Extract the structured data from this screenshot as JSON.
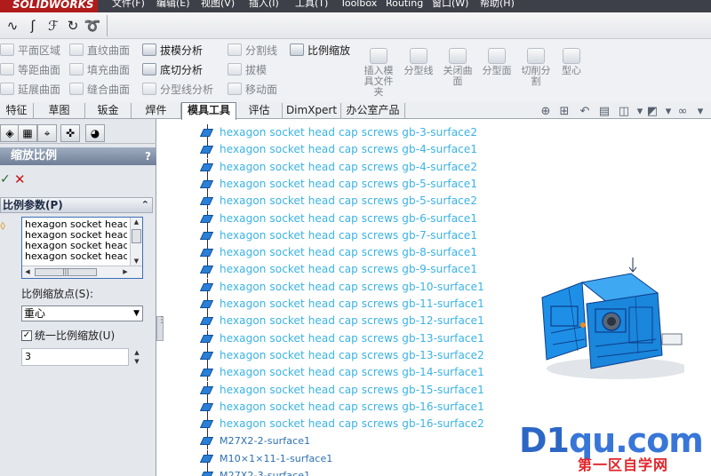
{
  "app": {
    "logo": "SOLIDWORKS"
  },
  "menu": [
    "文件(F)",
    "编辑(E)",
    "视图(V)",
    "插入(I)",
    "工具(T)",
    "Toolbox",
    "Routing",
    "窗口(W)",
    "帮助(H)"
  ],
  "ribbon": {
    "col1": [
      "平面区域",
      "等距曲面",
      "延展曲面"
    ],
    "col2": [
      "直纹曲面",
      "填充曲面",
      "缝合曲面"
    ],
    "col3": [
      "拔模分析",
      "底切分析",
      "分型线分析"
    ],
    "col4": [
      "分割线",
      "拔模",
      "移动面"
    ],
    "col5": [
      "比例缩放"
    ],
    "big": [
      "插入模具文件夹",
      "分型线",
      "关闭曲面",
      "分型面",
      "切削分割",
      "型心"
    ]
  },
  "tabs": [
    "特征",
    "草图",
    "钣金",
    "焊件",
    "模具工具",
    "评估",
    "DimXpert",
    "办公室产品"
  ],
  "active_tab": "模具工具",
  "panel": {
    "title": "缩放比例",
    "help": "?",
    "group_title": "比例参数(P)",
    "faces": [
      "hexagon socket head cap",
      "hexagon socket head cap",
      "hexagon socket head cap",
      "hexagon socket head cap"
    ],
    "scale_point_label": "比例缩放点(S):",
    "scale_point_value": "重心",
    "uniform_label": "统一比例缩放(U)",
    "uniform_checked": true,
    "scale_value": "3"
  },
  "tree": [
    "hexagon socket head cap screws gb-3-surface2",
    "hexagon socket head cap screws gb-4-surface1",
    "hexagon socket head cap screws gb-4-surface2",
    "hexagon socket head cap screws gb-5-surface1",
    "hexagon socket head cap screws gb-5-surface2",
    "hexagon socket head cap screws gb-6-surface1",
    "hexagon socket head cap screws gb-7-surface1",
    "hexagon socket head cap screws gb-8-surface1",
    "hexagon socket head cap screws gb-9-surface1",
    "hexagon socket head cap screws gb-10-surface1",
    "hexagon socket head cap screws gb-11-surface1",
    "hexagon socket head cap screws gb-12-surface1",
    "hexagon socket head cap screws gb-13-surface1",
    "hexagon socket head cap screws gb-13-surface2",
    "hexagon socket head cap screws gb-14-surface1",
    "hexagon socket head cap screws gb-15-surface1",
    "hexagon socket head cap screws gb-16-surface1",
    "hexagon socket head cap screws gb-16-surface2",
    "M27X2-2-surface1",
    "M10×1×11-1-surface1",
    "M27X2-3-surface1"
  ],
  "watermark": {
    "main_a": "D1",
    "main_b": "qu.com",
    "sub": "第一区自学网"
  },
  "colors": {
    "selected_text": "#39b3e6",
    "model_blue": "#1e8fe6",
    "accent_red": "#b01b1b"
  }
}
